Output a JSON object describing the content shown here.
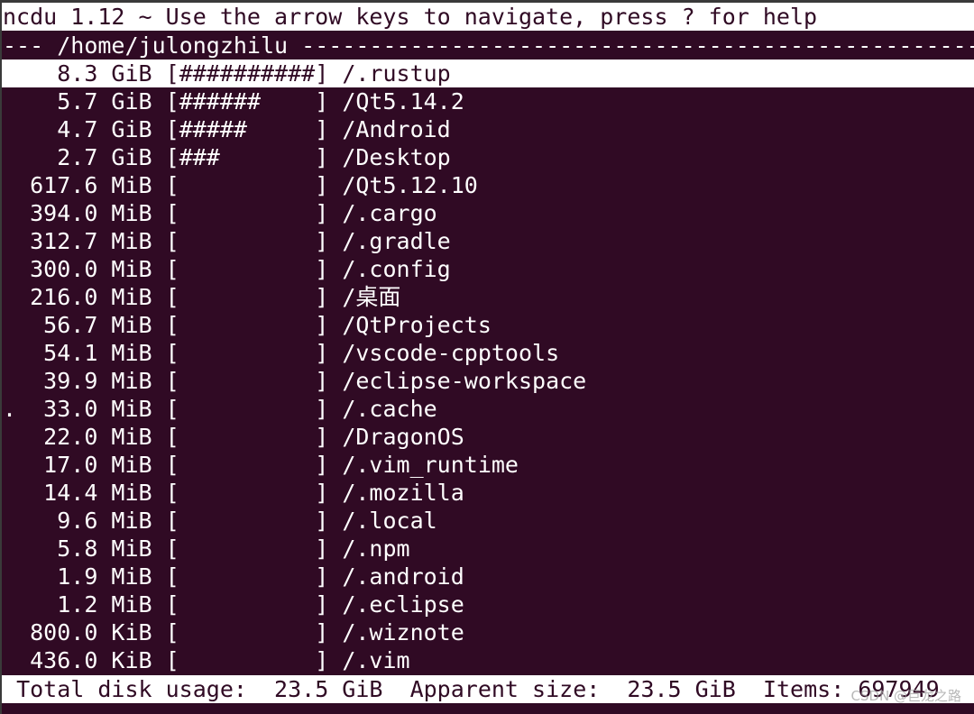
{
  "title_bar": "ncdu 1.12 ~ Use the arrow keys to navigate, press ? for help",
  "header": {
    "prefix": "--- ",
    "path": "/home/julongzhilu",
    "fill_char": "-"
  },
  "rows": [
    {
      "flag": " ",
      "size": "8.3 GiB",
      "bar": "##########",
      "name": "/.rustup",
      "selected": true
    },
    {
      "flag": " ",
      "size": "5.7 GiB",
      "bar": "######",
      "name": "/Qt5.14.2"
    },
    {
      "flag": " ",
      "size": "4.7 GiB",
      "bar": "#####",
      "name": "/Android"
    },
    {
      "flag": " ",
      "size": "2.7 GiB",
      "bar": "###",
      "name": "/Desktop"
    },
    {
      "flag": " ",
      "size": "617.6 MiB",
      "bar": "",
      "name": "/Qt5.12.10"
    },
    {
      "flag": " ",
      "size": "394.0 MiB",
      "bar": "",
      "name": "/.cargo"
    },
    {
      "flag": " ",
      "size": "312.7 MiB",
      "bar": "",
      "name": "/.gradle"
    },
    {
      "flag": " ",
      "size": "300.0 MiB",
      "bar": "",
      "name": "/.config"
    },
    {
      "flag": " ",
      "size": "216.0 MiB",
      "bar": "",
      "name": "/桌面"
    },
    {
      "flag": " ",
      "size": "56.7 MiB",
      "bar": "",
      "name": "/QtProjects"
    },
    {
      "flag": " ",
      "size": "54.1 MiB",
      "bar": "",
      "name": "/vscode-cpptools"
    },
    {
      "flag": " ",
      "size": "39.9 MiB",
      "bar": "",
      "name": "/eclipse-workspace"
    },
    {
      "flag": ".",
      "size": "33.0 MiB",
      "bar": "",
      "name": "/.cache"
    },
    {
      "flag": " ",
      "size": "22.0 MiB",
      "bar": "",
      "name": "/DragonOS"
    },
    {
      "flag": " ",
      "size": "17.0 MiB",
      "bar": "",
      "name": "/.vim_runtime"
    },
    {
      "flag": " ",
      "size": "14.4 MiB",
      "bar": "",
      "name": "/.mozilla"
    },
    {
      "flag": " ",
      "size": "9.6 MiB",
      "bar": "",
      "name": "/.local"
    },
    {
      "flag": " ",
      "size": "5.8 MiB",
      "bar": "",
      "name": "/.npm"
    },
    {
      "flag": " ",
      "size": "1.9 MiB",
      "bar": "",
      "name": "/.android"
    },
    {
      "flag": " ",
      "size": "1.2 MiB",
      "bar": "",
      "name": "/.eclipse"
    },
    {
      "flag": " ",
      "size": "800.0 KiB",
      "bar": "",
      "name": "/.wiznote"
    },
    {
      "flag": " ",
      "size": "436.0 KiB",
      "bar": "",
      "name": "/.vim"
    }
  ],
  "footer": {
    "disk_usage_label": "Total disk usage:",
    "disk_usage": "23.5 GiB",
    "apparent_label": "Apparent size:",
    "apparent": "23.5 GiB",
    "items_label": "Items:",
    "items": "697949"
  },
  "watermark": "CSDN @巨龙之路",
  "colors": {
    "background": "#300a24",
    "foreground": "#ffffff"
  }
}
